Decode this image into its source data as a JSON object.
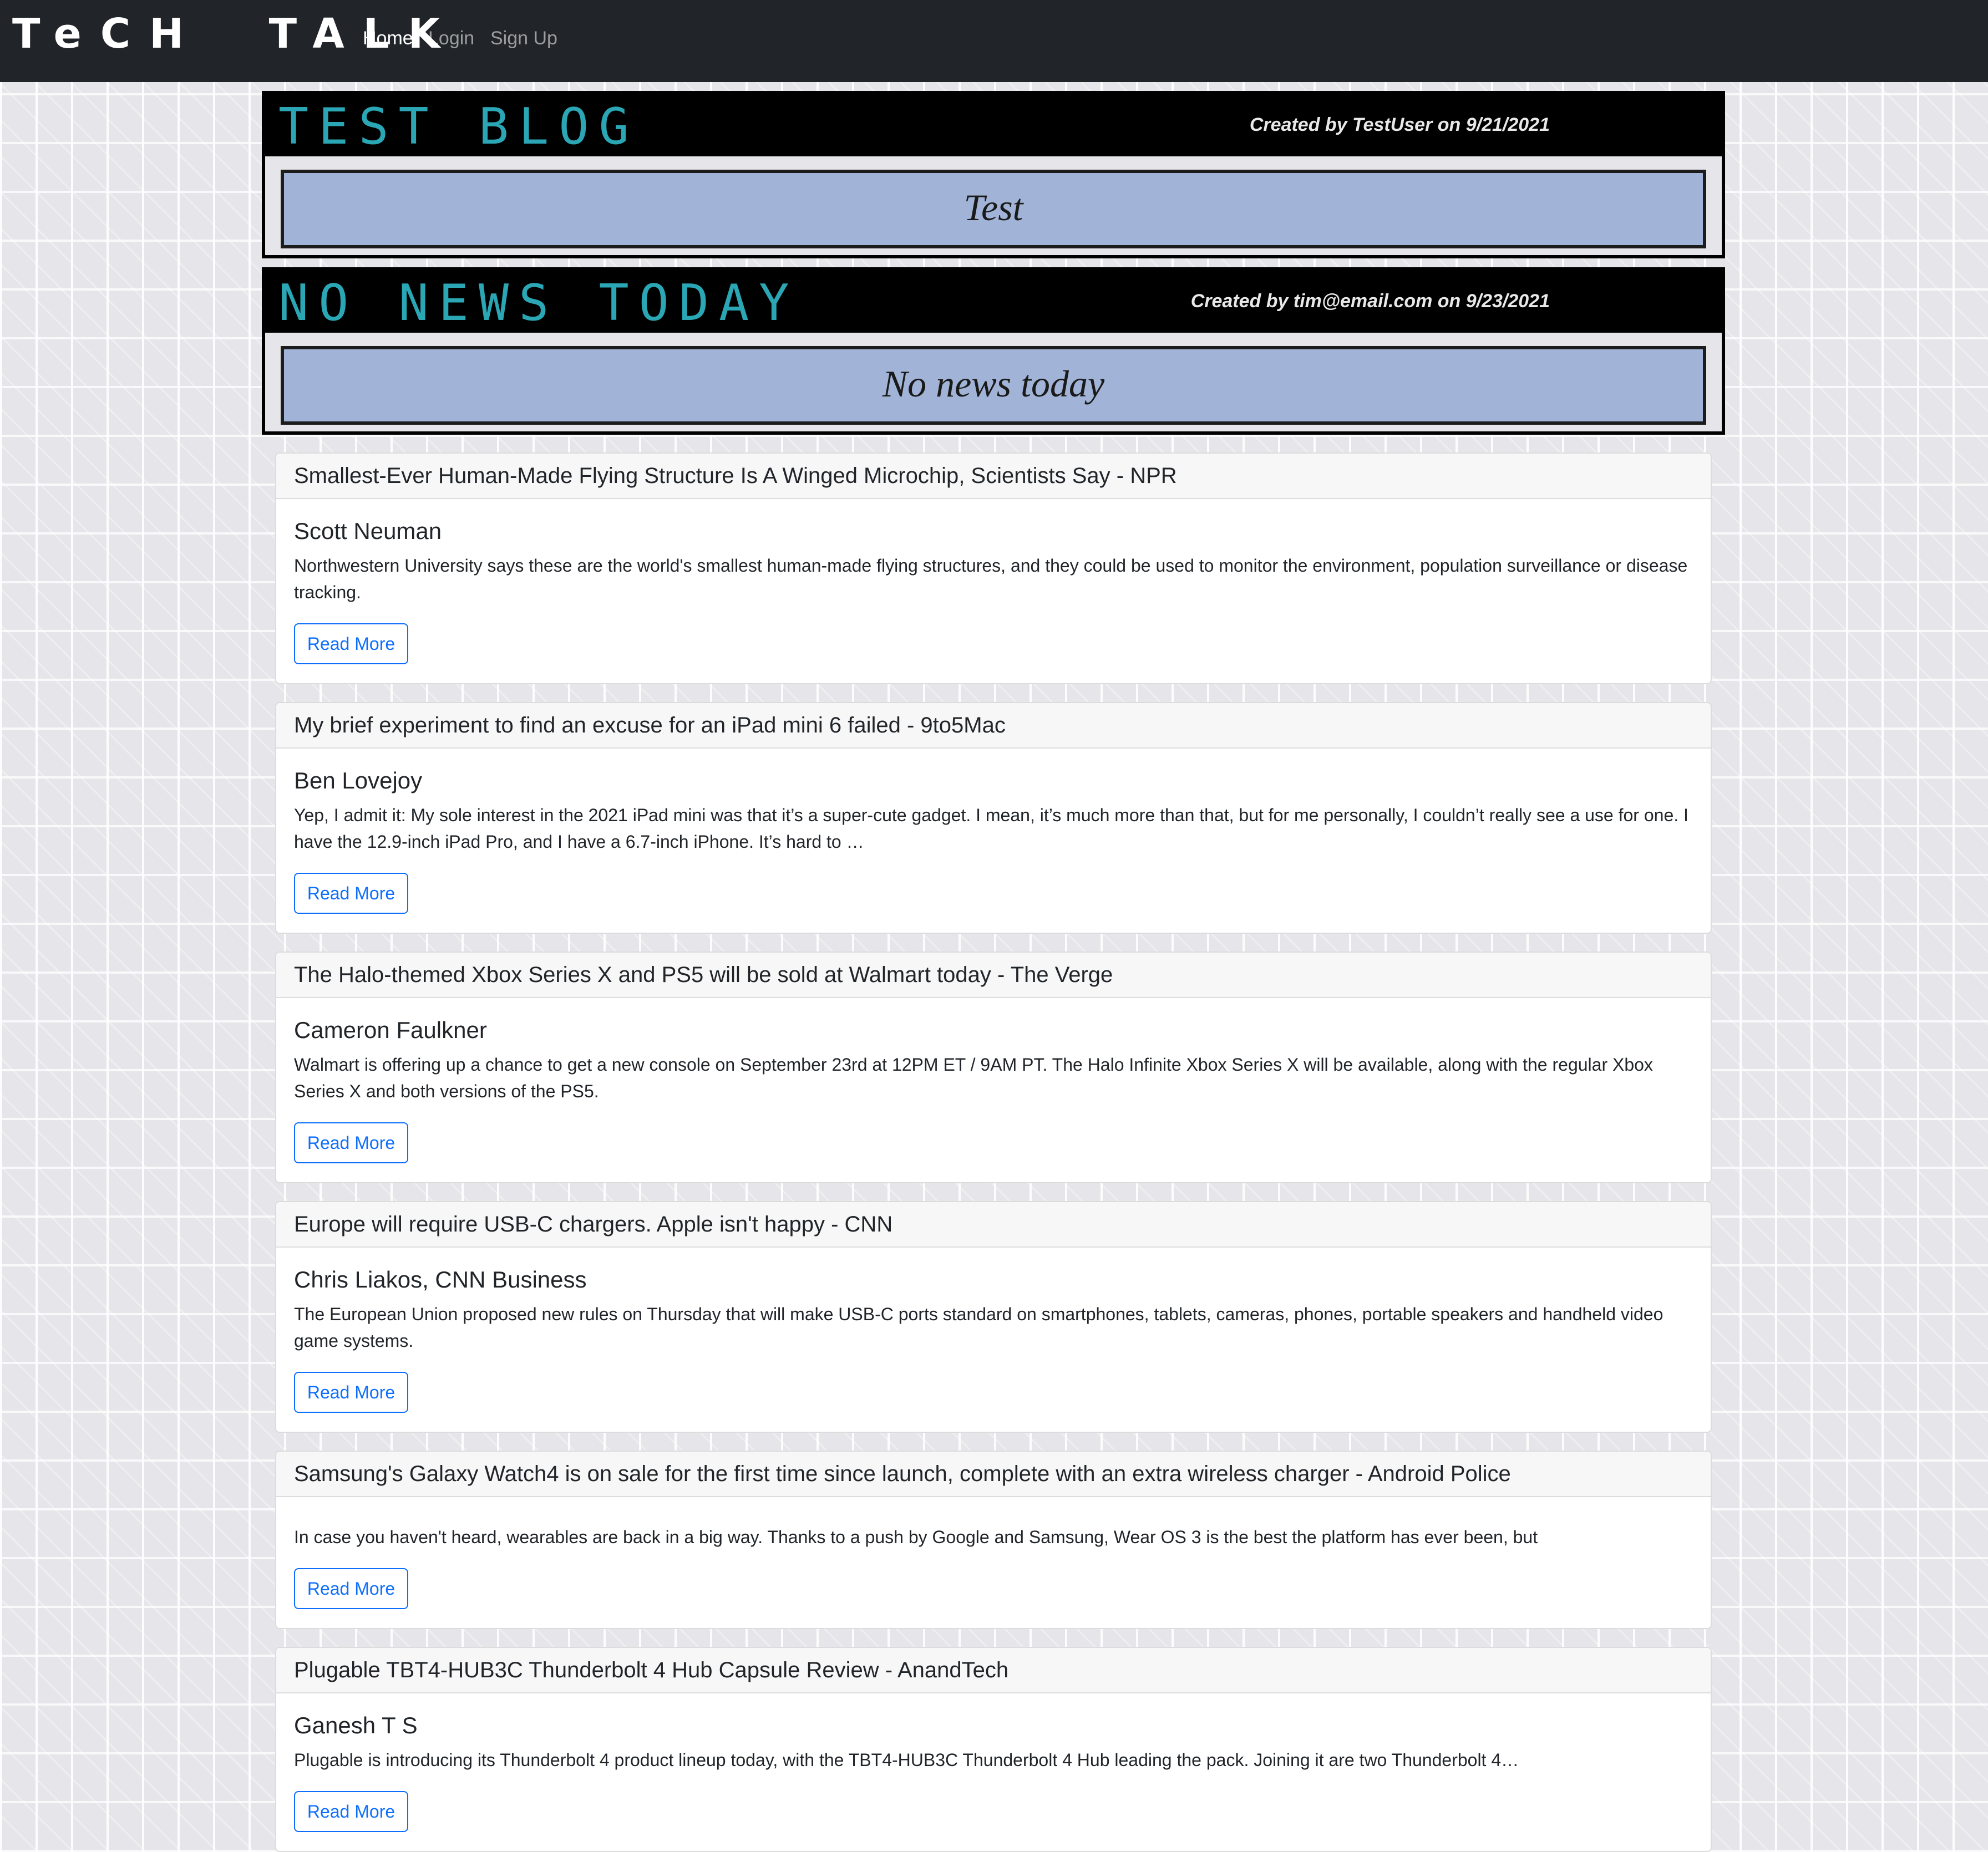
{
  "navbar": {
    "brand": "TeCH  TALK",
    "links": [
      {
        "label": "Home",
        "active": true
      },
      {
        "label": "Login",
        "active": false
      },
      {
        "label": "Sign Up",
        "active": false
      }
    ]
  },
  "blog_posts": [
    {
      "title": "TEST BLOG",
      "meta": "Created by TestUser on 9/21/2021",
      "body": "Test"
    },
    {
      "title": "NO NEWS TODAY",
      "meta": "Created by tim@email.com on 9/23/2021",
      "body": "No news today"
    }
  ],
  "news": [
    {
      "title": "Smallest-Ever Human-Made Flying Structure Is A Winged Microchip, Scientists Say - NPR",
      "author": "Scott Neuman",
      "description": "Northwestern University says these are the world's smallest human-made flying structures, and they could be used to monitor the environment, population surveillance or disease tracking.",
      "button": "Read More"
    },
    {
      "title": "My brief experiment to find an excuse for an iPad mini 6 failed - 9to5Mac",
      "author": "Ben Lovejoy",
      "description": "Yep, I admit it: My sole interest in the 2021 iPad mini was that it’s a super-cute gadget. I mean, it’s much more than that, but for me personally, I couldn’t really see a use for one. I have the 12.9-inch iPad Pro, and I have a 6.7-inch iPhone. It’s hard to …",
      "button": "Read More"
    },
    {
      "title": "The Halo-themed Xbox Series X and PS5 will be sold at Walmart today - The Verge",
      "author": "Cameron Faulkner",
      "description": "Walmart is offering up a chance to get a new console on September 23rd at 12PM ET / 9AM PT. The Halo Infinite Xbox Series X will be available, along with the regular Xbox Series X and both versions of the PS5.",
      "button": "Read More"
    },
    {
      "title": "Europe will require USB-C chargers. Apple isn't happy - CNN",
      "author": "Chris Liakos, CNN Business",
      "description": "The European Union proposed new rules on Thursday that will make USB-C ports standard on smartphones, tablets, cameras, phones, portable speakers and handheld video game systems.",
      "button": "Read More"
    },
    {
      "title": "Samsung's Galaxy Watch4 is on sale for the first time since launch, complete with an extra wireless charger - Android Police",
      "author": "",
      "description": "In case you haven't heard, wearables are back in a big way. Thanks to a push by Google and Samsung, Wear OS 3 is the best the platform has ever been, but",
      "button": "Read More"
    },
    {
      "title": "Plugable TBT4-HUB3C Thunderbolt 4 Hub Capsule Review - AnandTech",
      "author": "Ganesh T S",
      "description": "Plugable is introducing its Thunderbolt 4 product lineup today, with the TBT4-HUB3C Thunderbolt 4 Hub leading the pack. Joining it are two Thunderbolt 4…",
      "button": "Read More"
    }
  ]
}
